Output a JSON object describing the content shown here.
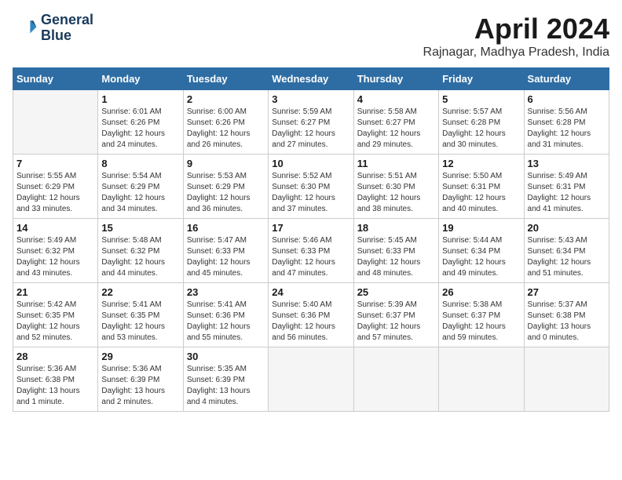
{
  "logo": {
    "line1": "General",
    "line2": "Blue"
  },
  "title": "April 2024",
  "subtitle": "Rajnagar, Madhya Pradesh, India",
  "days_of_week": [
    "Sunday",
    "Monday",
    "Tuesday",
    "Wednesday",
    "Thursday",
    "Friday",
    "Saturday"
  ],
  "weeks": [
    [
      {
        "num": "",
        "sunrise": "",
        "sunset": "",
        "daylight": ""
      },
      {
        "num": "1",
        "sunrise": "Sunrise: 6:01 AM",
        "sunset": "Sunset: 6:26 PM",
        "daylight": "Daylight: 12 hours and 24 minutes."
      },
      {
        "num": "2",
        "sunrise": "Sunrise: 6:00 AM",
        "sunset": "Sunset: 6:26 PM",
        "daylight": "Daylight: 12 hours and 26 minutes."
      },
      {
        "num": "3",
        "sunrise": "Sunrise: 5:59 AM",
        "sunset": "Sunset: 6:27 PM",
        "daylight": "Daylight: 12 hours and 27 minutes."
      },
      {
        "num": "4",
        "sunrise": "Sunrise: 5:58 AM",
        "sunset": "Sunset: 6:27 PM",
        "daylight": "Daylight: 12 hours and 29 minutes."
      },
      {
        "num": "5",
        "sunrise": "Sunrise: 5:57 AM",
        "sunset": "Sunset: 6:28 PM",
        "daylight": "Daylight: 12 hours and 30 minutes."
      },
      {
        "num": "6",
        "sunrise": "Sunrise: 5:56 AM",
        "sunset": "Sunset: 6:28 PM",
        "daylight": "Daylight: 12 hours and 31 minutes."
      }
    ],
    [
      {
        "num": "7",
        "sunrise": "Sunrise: 5:55 AM",
        "sunset": "Sunset: 6:29 PM",
        "daylight": "Daylight: 12 hours and 33 minutes."
      },
      {
        "num": "8",
        "sunrise": "Sunrise: 5:54 AM",
        "sunset": "Sunset: 6:29 PM",
        "daylight": "Daylight: 12 hours and 34 minutes."
      },
      {
        "num": "9",
        "sunrise": "Sunrise: 5:53 AM",
        "sunset": "Sunset: 6:29 PM",
        "daylight": "Daylight: 12 hours and 36 minutes."
      },
      {
        "num": "10",
        "sunrise": "Sunrise: 5:52 AM",
        "sunset": "Sunset: 6:30 PM",
        "daylight": "Daylight: 12 hours and 37 minutes."
      },
      {
        "num": "11",
        "sunrise": "Sunrise: 5:51 AM",
        "sunset": "Sunset: 6:30 PM",
        "daylight": "Daylight: 12 hours and 38 minutes."
      },
      {
        "num": "12",
        "sunrise": "Sunrise: 5:50 AM",
        "sunset": "Sunset: 6:31 PM",
        "daylight": "Daylight: 12 hours and 40 minutes."
      },
      {
        "num": "13",
        "sunrise": "Sunrise: 5:49 AM",
        "sunset": "Sunset: 6:31 PM",
        "daylight": "Daylight: 12 hours and 41 minutes."
      }
    ],
    [
      {
        "num": "14",
        "sunrise": "Sunrise: 5:49 AM",
        "sunset": "Sunset: 6:32 PM",
        "daylight": "Daylight: 12 hours and 43 minutes."
      },
      {
        "num": "15",
        "sunrise": "Sunrise: 5:48 AM",
        "sunset": "Sunset: 6:32 PM",
        "daylight": "Daylight: 12 hours and 44 minutes."
      },
      {
        "num": "16",
        "sunrise": "Sunrise: 5:47 AM",
        "sunset": "Sunset: 6:33 PM",
        "daylight": "Daylight: 12 hours and 45 minutes."
      },
      {
        "num": "17",
        "sunrise": "Sunrise: 5:46 AM",
        "sunset": "Sunset: 6:33 PM",
        "daylight": "Daylight: 12 hours and 47 minutes."
      },
      {
        "num": "18",
        "sunrise": "Sunrise: 5:45 AM",
        "sunset": "Sunset: 6:33 PM",
        "daylight": "Daylight: 12 hours and 48 minutes."
      },
      {
        "num": "19",
        "sunrise": "Sunrise: 5:44 AM",
        "sunset": "Sunset: 6:34 PM",
        "daylight": "Daylight: 12 hours and 49 minutes."
      },
      {
        "num": "20",
        "sunrise": "Sunrise: 5:43 AM",
        "sunset": "Sunset: 6:34 PM",
        "daylight": "Daylight: 12 hours and 51 minutes."
      }
    ],
    [
      {
        "num": "21",
        "sunrise": "Sunrise: 5:42 AM",
        "sunset": "Sunset: 6:35 PM",
        "daylight": "Daylight: 12 hours and 52 minutes."
      },
      {
        "num": "22",
        "sunrise": "Sunrise: 5:41 AM",
        "sunset": "Sunset: 6:35 PM",
        "daylight": "Daylight: 12 hours and 53 minutes."
      },
      {
        "num": "23",
        "sunrise": "Sunrise: 5:41 AM",
        "sunset": "Sunset: 6:36 PM",
        "daylight": "Daylight: 12 hours and 55 minutes."
      },
      {
        "num": "24",
        "sunrise": "Sunrise: 5:40 AM",
        "sunset": "Sunset: 6:36 PM",
        "daylight": "Daylight: 12 hours and 56 minutes."
      },
      {
        "num": "25",
        "sunrise": "Sunrise: 5:39 AM",
        "sunset": "Sunset: 6:37 PM",
        "daylight": "Daylight: 12 hours and 57 minutes."
      },
      {
        "num": "26",
        "sunrise": "Sunrise: 5:38 AM",
        "sunset": "Sunset: 6:37 PM",
        "daylight": "Daylight: 12 hours and 59 minutes."
      },
      {
        "num": "27",
        "sunrise": "Sunrise: 5:37 AM",
        "sunset": "Sunset: 6:38 PM",
        "daylight": "Daylight: 13 hours and 0 minutes."
      }
    ],
    [
      {
        "num": "28",
        "sunrise": "Sunrise: 5:36 AM",
        "sunset": "Sunset: 6:38 PM",
        "daylight": "Daylight: 13 hours and 1 minute."
      },
      {
        "num": "29",
        "sunrise": "Sunrise: 5:36 AM",
        "sunset": "Sunset: 6:39 PM",
        "daylight": "Daylight: 13 hours and 2 minutes."
      },
      {
        "num": "30",
        "sunrise": "Sunrise: 5:35 AM",
        "sunset": "Sunset: 6:39 PM",
        "daylight": "Daylight: 13 hours and 4 minutes."
      },
      {
        "num": "",
        "sunrise": "",
        "sunset": "",
        "daylight": ""
      },
      {
        "num": "",
        "sunrise": "",
        "sunset": "",
        "daylight": ""
      },
      {
        "num": "",
        "sunrise": "",
        "sunset": "",
        "daylight": ""
      },
      {
        "num": "",
        "sunrise": "",
        "sunset": "",
        "daylight": ""
      }
    ]
  ]
}
